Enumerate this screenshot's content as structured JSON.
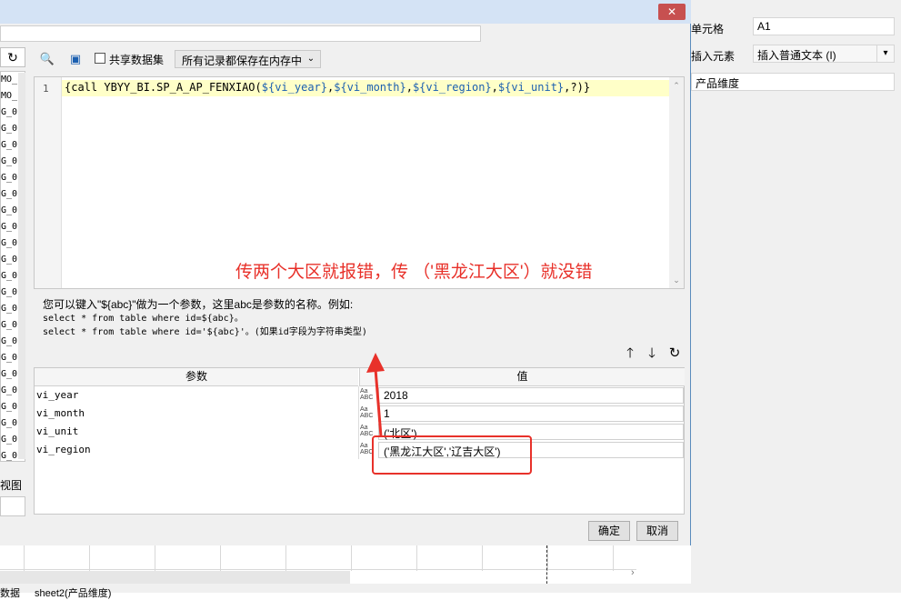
{
  "right_panel": {
    "cell_label": "单元格",
    "cell_value": "A1",
    "insert_label": "插入元素",
    "insert_value": "插入普通文本 (I)",
    "dimension_label": "产品维度"
  },
  "dialog": {
    "close_icon": "close-icon",
    "left_list": {
      "items": [
        "MO_",
        "MO_",
        "G_0",
        "G_0",
        "G_0",
        "G_0",
        "G_0",
        "G_0",
        "G_0",
        "G_0",
        "G_0",
        "G_0",
        "G_0",
        "G_0",
        "G_0",
        "G_0",
        "G_0",
        "G_0",
        "G_0",
        "G_0",
        "G_0",
        "G_0",
        "G_0",
        "G_0"
      ],
      "view_label": "视图"
    },
    "toolbar": {
      "share_label": "共享数据集",
      "memory_option": "所有记录都保存在内存中"
    },
    "editor": {
      "line_number": "1",
      "sql_prefix": "{call YBYY_BI.SP_A_AP_FENXIAO(",
      "sql_var1": "${vi_year}",
      "sql_comma1": ",",
      "sql_var2": "${vi_month}",
      "sql_comma2": ",",
      "sql_var3": "${vi_region}",
      "sql_comma3": ",",
      "sql_var4": "${vi_unit}",
      "sql_suffix": ",?)}"
    },
    "annotation": "传两个大区就报错，传 （'黑龙江大区'）就没错",
    "help": {
      "line1": "您可以键入\"${abc}\"做为一个参数，这里abc是参数的名称。例如:",
      "line2": "select * from table where id=${abc}。",
      "line3": "select * from table where id='${abc}'。(如果id字段为字符串类型)"
    },
    "param_table": {
      "header_param": "参数",
      "header_value": "值",
      "rows": [
        {
          "name": "vi_year",
          "value": "2018"
        },
        {
          "name": "vi_month",
          "value": "1"
        },
        {
          "name": "vi_unit",
          "value": "('北区')"
        },
        {
          "name": "vi_region",
          "value": "('黑龙江大区','辽吉大区')"
        }
      ]
    },
    "ok_label": "确定",
    "cancel_label": "取消"
  },
  "sheet": {
    "left_tab": "数据",
    "tab": "sheet2(产品维度)"
  },
  "colors": {
    "annotation": "#e8312a",
    "highlight_line": "#ffffc8",
    "titlebar": "#d4e3f5"
  }
}
